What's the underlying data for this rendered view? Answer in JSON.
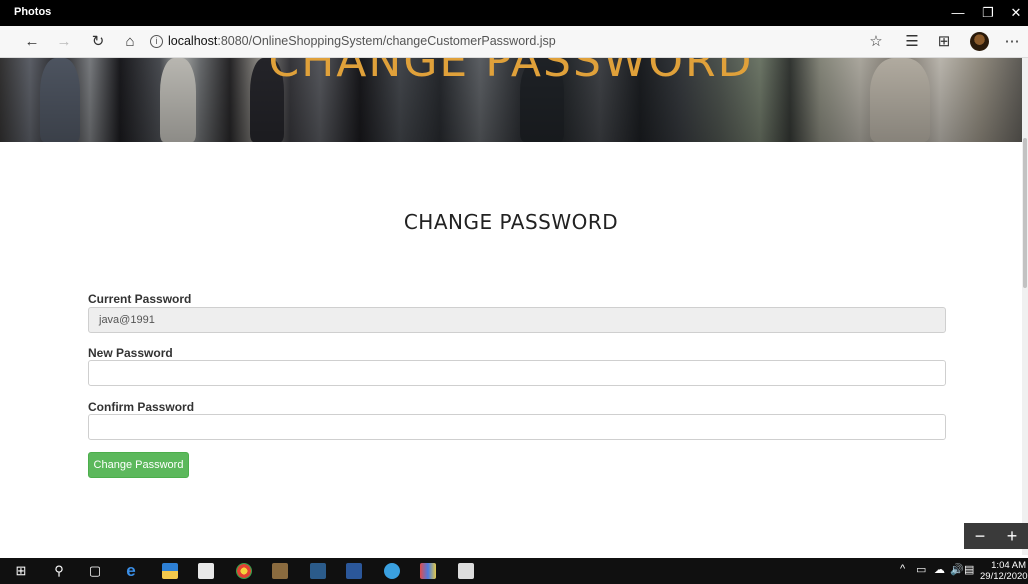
{
  "window": {
    "app_title": "Photos",
    "minimize": "—",
    "restore": "❐",
    "close": "✕"
  },
  "browser": {
    "url_host": "localhost",
    "url_rest": ":8080/OnlineShoppingSystem/changeCustomerPassword.jsp",
    "icons": {
      "back": "←",
      "forward": "→",
      "refresh": "↻",
      "home": "⌂",
      "info": "i",
      "favorite": "☆",
      "favorites_list": "☰",
      "collections": "⊞",
      "more": "⋯"
    }
  },
  "hero": {
    "title": "CHANGE PASSWORD"
  },
  "form": {
    "heading": "CHANGE PASSWORD",
    "current_label": "Current Password",
    "current_value": "java@1991",
    "new_label": "New Password",
    "new_value": "",
    "confirm_label": "Confirm Password",
    "confirm_value": "",
    "submit_label": "Change Password"
  },
  "zoom": {
    "minus": "−",
    "plus": "+"
  },
  "taskbar": {
    "start": "⊞",
    "search": "⚲",
    "task_view": "▢",
    "edge": "e",
    "tray_chevron": "^",
    "volume": "🔊",
    "time": "1:04 AM",
    "date": "29/12/2020"
  },
  "colors": {
    "accent_green": "#5cb85c",
    "hero_title": "#e0a13a"
  }
}
